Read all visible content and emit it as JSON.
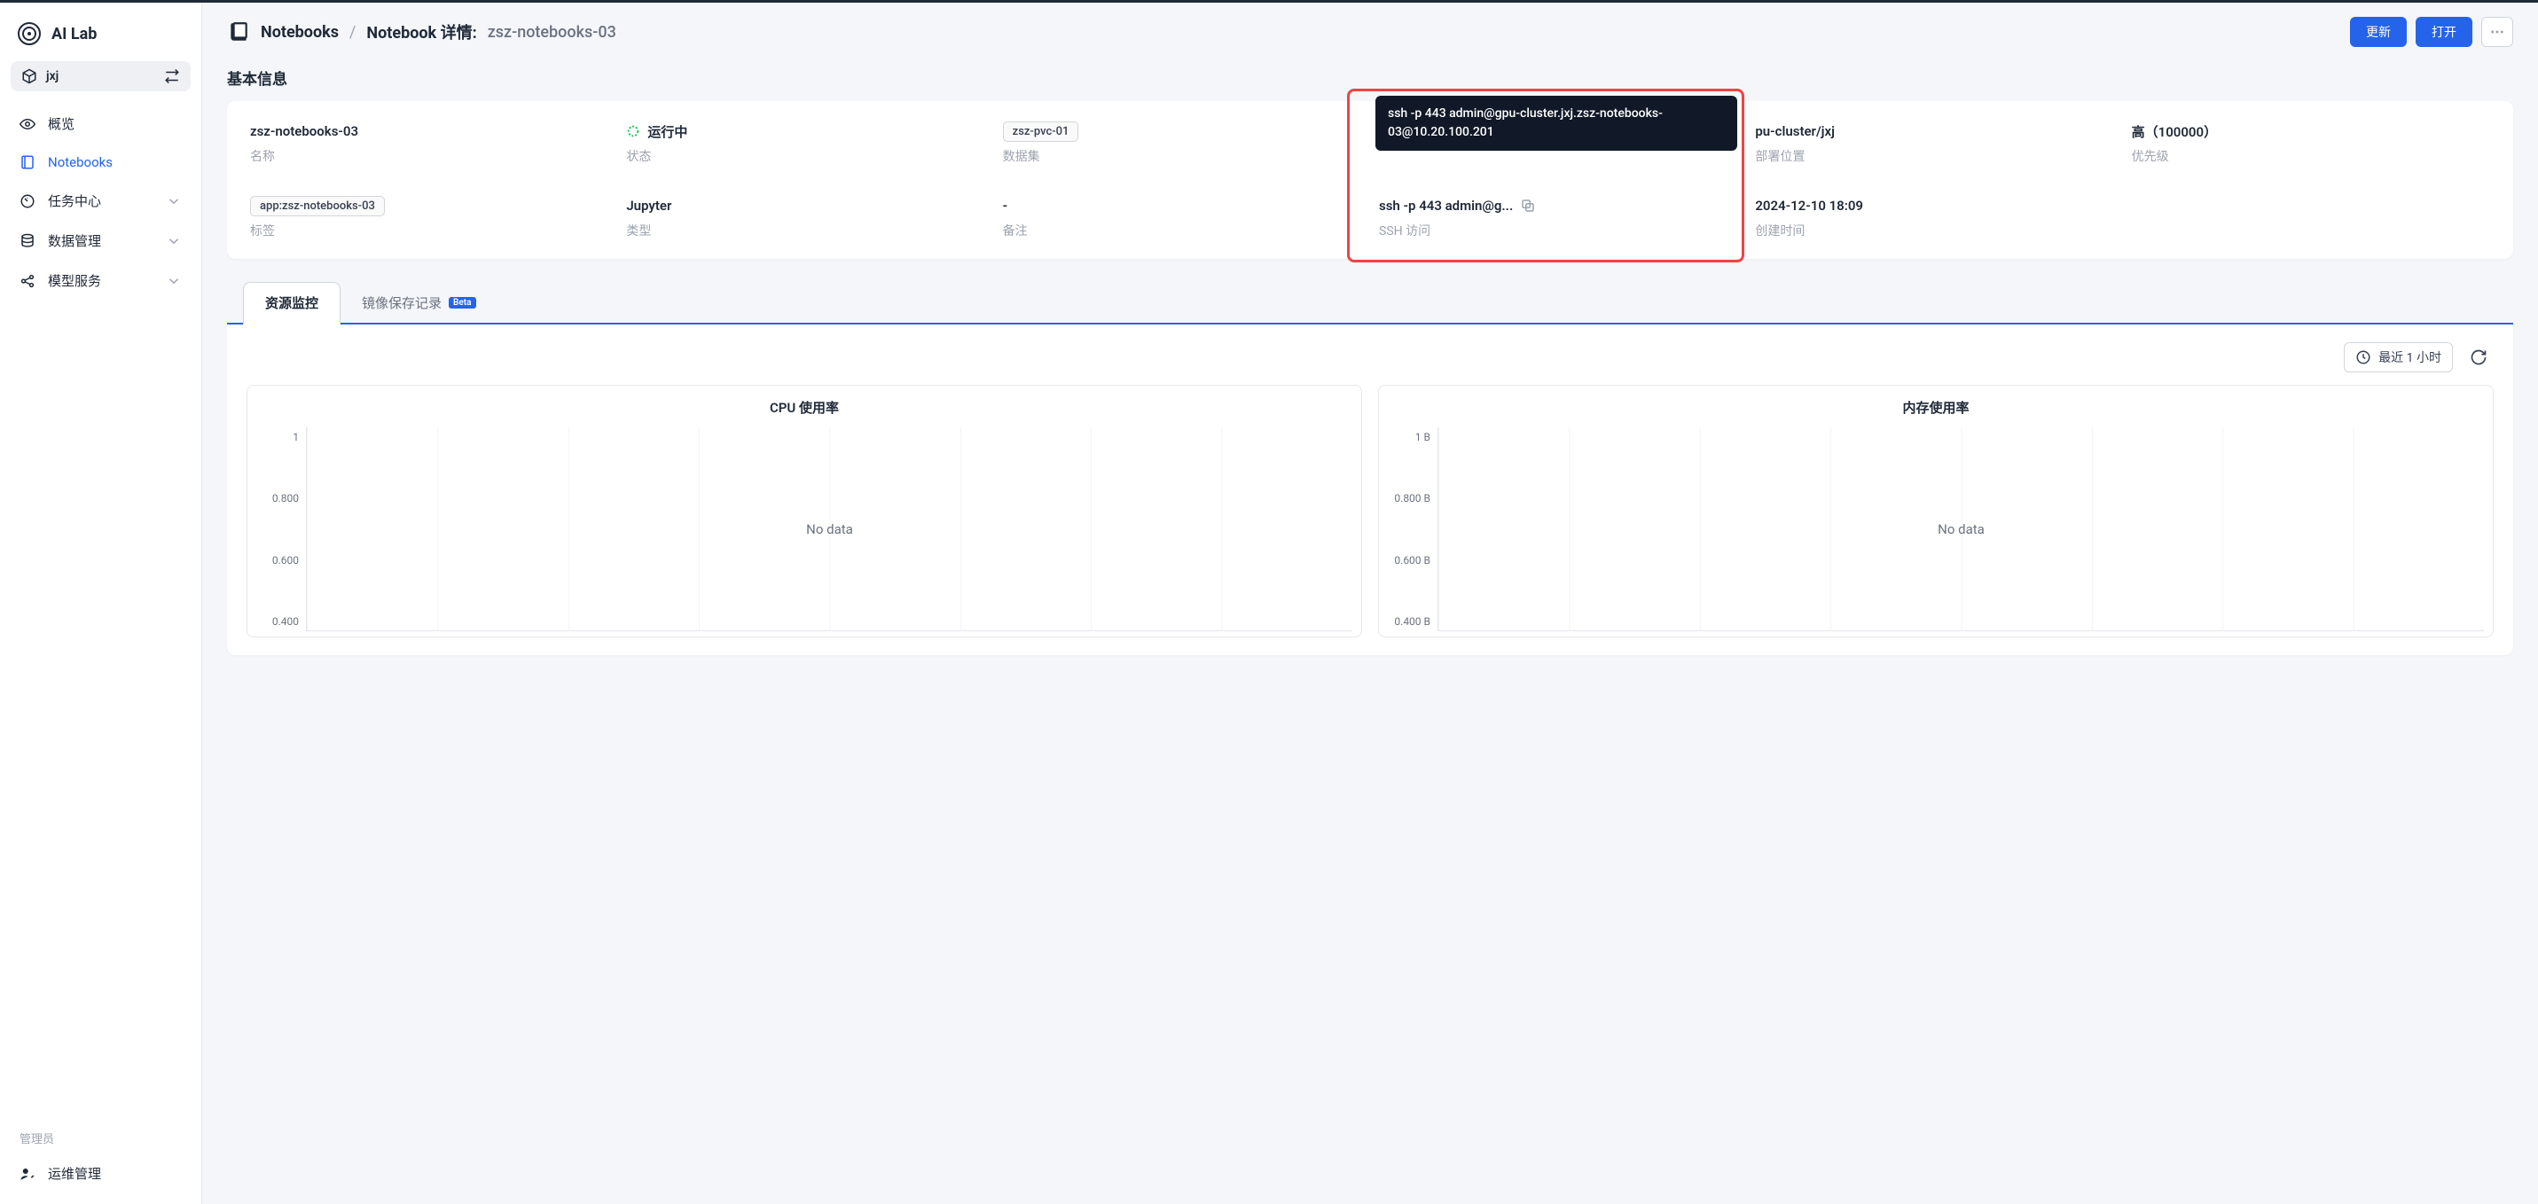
{
  "brand": {
    "title": "AI Lab"
  },
  "project": {
    "name": "jxj"
  },
  "sidebar": {
    "items": [
      {
        "label": "概览",
        "icon": "eye-icon"
      },
      {
        "label": "Notebooks",
        "icon": "notebook-icon",
        "active": true
      },
      {
        "label": "任务中心",
        "icon": "gauge-icon",
        "expandable": true
      },
      {
        "label": "数据管理",
        "icon": "database-icon",
        "expandable": true
      },
      {
        "label": "模型服务",
        "icon": "share-icon",
        "expandable": true
      }
    ],
    "admin_label": "管理员",
    "admin_item": {
      "label": "运维管理",
      "icon": "user-wrench-icon"
    }
  },
  "breadcrumb": {
    "parent": "Notebooks",
    "detail_prefix": "Notebook 详情:",
    "detail_name": "zsz-notebooks-03"
  },
  "actions": {
    "update": "更新",
    "open": "打开"
  },
  "section": {
    "basic_info": "基本信息"
  },
  "info": {
    "name": {
      "value": "zsz-notebooks-03",
      "label": "名称"
    },
    "status": {
      "value": "运行中",
      "label": "状态"
    },
    "dataset": {
      "value": "zsz-pvc-01",
      "label": "数据集"
    },
    "location": {
      "value_full": "gpu-cluster/jxj",
      "value_visible": "pu-cluster/jxj",
      "label": "部署位置"
    },
    "priority": {
      "value": "高（100000）",
      "label": "优先级"
    },
    "tags": {
      "value": "app:zsz-notebooks-03",
      "label": "标签"
    },
    "type": {
      "value": "Jupyter",
      "label": "类型"
    },
    "remark": {
      "value": "-",
      "label": "备注"
    },
    "ssh": {
      "value_short": "ssh -p 443 admin@g...",
      "value_full": "ssh -p 443 admin@gpu-cluster.jxj.zsz-notebooks-03@10.20.100.201",
      "label": "SSH 访问"
    },
    "created": {
      "value": "2024-12-10 18:09",
      "label": "创建时间"
    }
  },
  "tabs": {
    "monitor": "资源监控",
    "snapshot": "镜像保存记录",
    "beta": "Beta"
  },
  "toolbar": {
    "time_range": "最近 1 小时"
  },
  "chart_data": [
    {
      "type": "line",
      "title": "CPU 使用率",
      "ylim": [
        0,
        1
      ],
      "yticks": [
        "1",
        "0.800",
        "0.600",
        "0.400"
      ],
      "series": [],
      "empty_text": "No data"
    },
    {
      "type": "line",
      "title": "内存使用率",
      "ylim": [
        0,
        1
      ],
      "yticks": [
        "1 B",
        "0.800 B",
        "0.600 B",
        "0.400 B"
      ],
      "series": [],
      "empty_text": "No data"
    }
  ]
}
